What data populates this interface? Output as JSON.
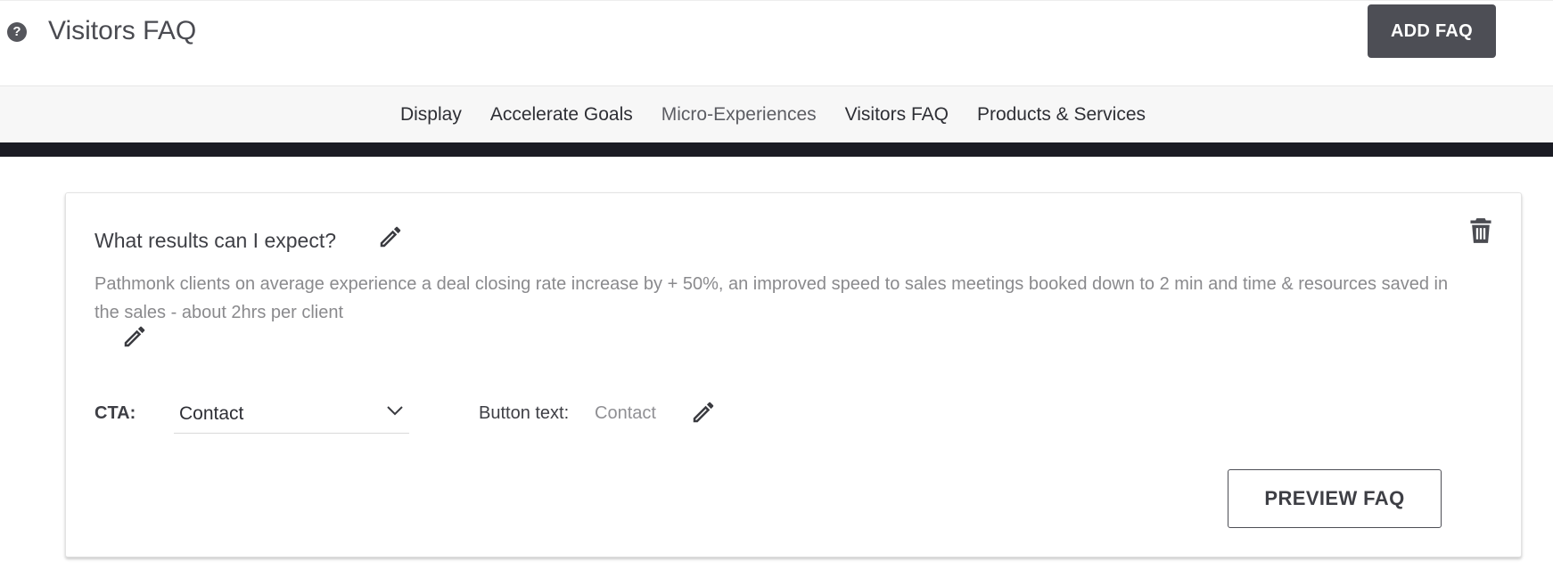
{
  "header": {
    "title": "Visitors FAQ",
    "help_icon": "question-circle-icon",
    "add_button_label": "ADD FAQ"
  },
  "nav": {
    "items": [
      {
        "label": "Display"
      },
      {
        "label": "Accelerate Goals"
      },
      {
        "label": "Micro-Experiences"
      },
      {
        "label": "Visitors FAQ"
      },
      {
        "label": "Products & Services"
      }
    ]
  },
  "faq": {
    "question": "What results can I expect?",
    "answer": "Pathmonk clients on average experience a deal closing rate increase by + 50%, an improved speed to sales meetings booked down to 2 min and time & resources saved in the sales - about 2hrs per client",
    "cta_label": "CTA:",
    "cta_value": "Contact",
    "button_text_label": "Button text:",
    "button_text_value": "Contact",
    "preview_button_label": "PREVIEW FAQ",
    "icons": {
      "edit": "pencil-icon",
      "delete": "trash-icon",
      "dropdown": "chevron-down-icon"
    }
  },
  "colors": {
    "primary_button": "#4d4e55",
    "dark_bar": "#1b1c24",
    "nav_background": "#f7f7f7",
    "muted_text": "#8a8a8d"
  }
}
